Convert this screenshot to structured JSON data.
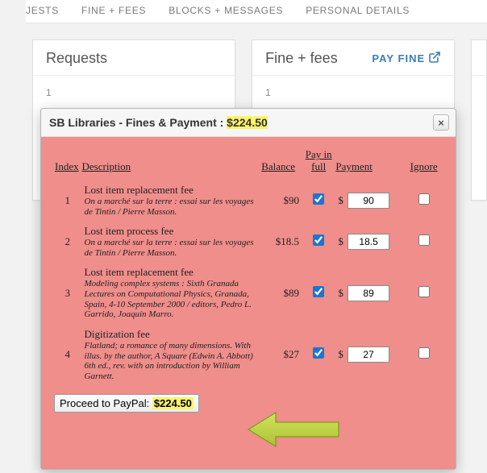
{
  "tabs": {
    "requests": "JESTS",
    "fines": "FINE + FEES",
    "blocks": "BLOCKS + MESSAGES",
    "personal": "PERSONAL DETAILS"
  },
  "cards": {
    "requests": {
      "title": "Requests",
      "count_label": "1"
    },
    "fines": {
      "title": "Fine + fees",
      "payfine_label": "PAY FINE",
      "count_label": "1"
    }
  },
  "dialog": {
    "title_prefix": "SB Libraries - Fines & Payment : ",
    "title_amount": "$224.50",
    "headers": {
      "index": "Index",
      "description": "Description",
      "balance": "Balance",
      "pay_in_full": "Pay in full",
      "payment": "Payment",
      "ignore": "Ignore"
    },
    "rows": [
      {
        "idx": "1",
        "name": "Lost item replacement fee",
        "note": "On a marché sur la terre : essai sur les voyages de Tintin / Pierre Masson.",
        "balance": "$90",
        "pif": true,
        "payment": "90",
        "ignore": false
      },
      {
        "idx": "2",
        "name": "Lost item process fee",
        "note": "On a marché sur la terre : essai sur les voyages de Tintin / Pierre Masson.",
        "balance": "$18.5",
        "pif": true,
        "payment": "18.5",
        "ignore": false
      },
      {
        "idx": "3",
        "name": "Lost item replacement fee",
        "note": "Modeling complex systems : Sixth Granada Lectures on Computational Physics, Granada, Spain, 4-10 September 2000 / editors, Pedro L. Garrido, Joaquín Marro.",
        "balance": "$89",
        "pif": true,
        "payment": "89",
        "ignore": false
      },
      {
        "idx": "4",
        "name": "Digitization fee",
        "note": "Flatland; a romance of many dimensions. With illus. by the author, A Square (Edwin A. Abbott) 6th ed., rev. with an introduction by William Garnett.",
        "balance": "$27",
        "pif": true,
        "payment": "27",
        "ignore": false
      }
    ],
    "proceed_prefix": "Proceed to PayPal: ",
    "proceed_amount": "$224.50"
  },
  "colors": {
    "highlight": "#fcf36a",
    "modal_bg": "#ef8e8b",
    "link": "#3a7cb6",
    "arrow": "#b9cf3a"
  },
  "glyphs": {
    "dollar": "$",
    "close": "×"
  }
}
